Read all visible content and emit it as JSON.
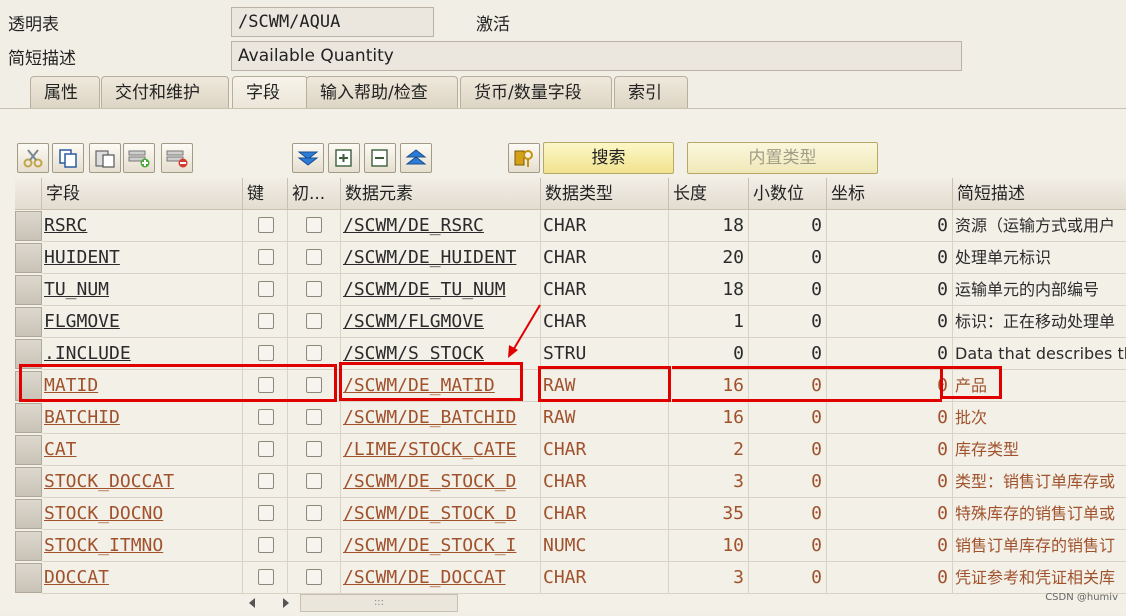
{
  "header": {
    "table_label": "透明表",
    "table_name": "/SCWM/AQUA",
    "status": "激活",
    "desc_label": "简短描述",
    "description": "Available Quantity"
  },
  "tabs": [
    {
      "label": "属性"
    },
    {
      "label": "交付和维护"
    },
    {
      "label": "字段",
      "active": true
    },
    {
      "label": "输入帮助/检查"
    },
    {
      "label": "货币/数量字段"
    },
    {
      "label": "索引"
    }
  ],
  "toolbar": {
    "search_label": "搜索",
    "builtin_type_label": "内置类型",
    "icons": [
      "cut-icon",
      "copy-icon",
      "paste-icon",
      "insert-row-icon",
      "delete-row-icon",
      "move-down-icon",
      "expand-icon",
      "collapse-icon",
      "move-up-icon",
      "key-icon"
    ]
  },
  "columns": [
    "字段",
    "键",
    "初...",
    "数据元素",
    "数据类型",
    "长度",
    "小数位",
    "坐标",
    "简短描述"
  ],
  "rows": [
    {
      "field": "RSRC",
      "element": "/SCWM/DE_RSRC",
      "type": "CHAR",
      "length": "18",
      "decimals": "0",
      "coord": "0",
      "desc": "资源（运输方式或用户",
      "brown": false
    },
    {
      "field": "HUIDENT",
      "element": "/SCWM/DE_HUIDENT",
      "type": "CHAR",
      "length": "20",
      "decimals": "0",
      "coord": "0",
      "desc": "处理单元标识",
      "brown": false
    },
    {
      "field": "TU_NUM",
      "element": "/SCWM/DE_TU_NUM",
      "type": "CHAR",
      "length": "18",
      "decimals": "0",
      "coord": "0",
      "desc": "运输单元的内部编号",
      "brown": false
    },
    {
      "field": "FLGMOVE",
      "element": "/SCWM/FLGMOVE",
      "type": "CHAR",
      "length": "1",
      "decimals": "0",
      "coord": "0",
      "desc": "标识：正在移动处理单",
      "brown": false
    },
    {
      "field": ".INCLUDE",
      "element": "/SCWM/S_STOCK",
      "type": "STRU",
      "length": "0",
      "decimals": "0",
      "coord": "0",
      "desc": "Data that describes th",
      "brown": false
    },
    {
      "field": "MATID",
      "element": "/SCWM/DE_MATID",
      "type": "RAW",
      "length": "16",
      "decimals": "0",
      "coord": "0",
      "desc": "产品",
      "brown": true
    },
    {
      "field": "BATCHID",
      "element": "/SCWM/DE_BATCHID",
      "type": "RAW",
      "length": "16",
      "decimals": "0",
      "coord": "0",
      "desc": "批次",
      "brown": true
    },
    {
      "field": "CAT",
      "element": "/LIME/STOCK_CATE",
      "type": "CHAR",
      "length": "2",
      "decimals": "0",
      "coord": "0",
      "desc": "库存类型",
      "brown": true
    },
    {
      "field": "STOCK_DOCCAT",
      "element": "/SCWM/DE_STOCK_D",
      "type": "CHAR",
      "length": "3",
      "decimals": "0",
      "coord": "0",
      "desc": "类型：销售订单库存或",
      "brown": true
    },
    {
      "field": "STOCK_DOCNO",
      "element": "/SCWM/DE_STOCK_D",
      "type": "CHAR",
      "length": "35",
      "decimals": "0",
      "coord": "0",
      "desc": "特殊库存的销售订单或",
      "brown": true
    },
    {
      "field": "STOCK_ITMNO",
      "element": "/SCWM/DE_STOCK_I",
      "type": "NUMC",
      "length": "10",
      "decimals": "0",
      "coord": "0",
      "desc": "销售订单库存的销售订",
      "brown": true
    },
    {
      "field": "DOCCAT",
      "element": "/SCWM/DE_DOCCAT",
      "type": "CHAR",
      "length": "3",
      "decimals": "0",
      "coord": "0",
      "desc": "凭证参考和凭证相关库",
      "brown": true
    }
  ],
  "scroll_grip": ":::",
  "watermark": "CSDN @humiv"
}
